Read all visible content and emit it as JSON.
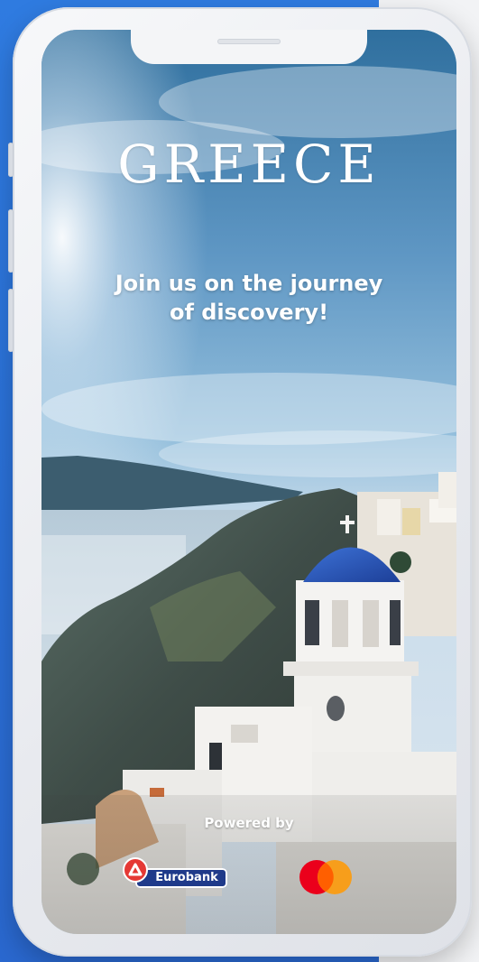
{
  "app": {
    "title": "GREECE",
    "tagline_line1": "Join us on the journey",
    "tagline_line2": "of discovery!",
    "powered_by": "Powered by"
  },
  "sponsors": {
    "eurobank": {
      "name": "Eurobank"
    },
    "mastercard": {
      "icon": "mastercard-logo"
    }
  },
  "colors": {
    "background_blue": "#2f7be0",
    "eurobank_blue": "#1f3a8a",
    "eurobank_red": "#e53935",
    "mastercard_red": "#eb001b",
    "mastercard_orange": "#f79e1b"
  }
}
